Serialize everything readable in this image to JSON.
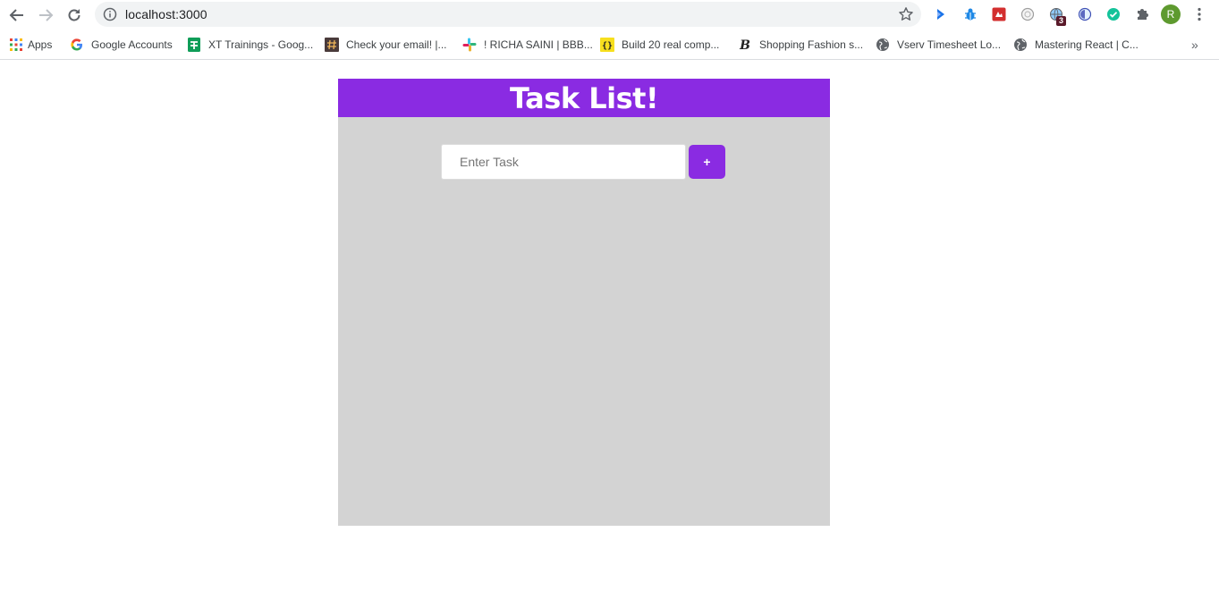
{
  "browser": {
    "url": "localhost:3000",
    "extension_badge": "3",
    "profile_initial": "R",
    "profile_color": "#5e9a2f",
    "bookmarks": [
      {
        "icon": "apps-grid-icon",
        "label": "Apps"
      },
      {
        "icon": "google-icon",
        "label": "Google Accounts"
      },
      {
        "icon": "sheets-icon",
        "label": "XT Trainings - Goog..."
      },
      {
        "icon": "hash-icon",
        "label": "Check your email! |..."
      },
      {
        "icon": "slack-icon",
        "label": "! RICHA SAINI | BBB..."
      },
      {
        "icon": "braces-icon",
        "label": "Build 20 real comp..."
      },
      {
        "icon": "script-b-icon",
        "label": "Shopping Fashion s..."
      },
      {
        "icon": "globe-icon",
        "label": "Vserv Timesheet Lo..."
      },
      {
        "icon": "globe-icon",
        "label": "Mastering React | C..."
      }
    ],
    "more_bookmarks": "»"
  },
  "app": {
    "title": "Task List!",
    "input_placeholder": "Enter Task",
    "input_value": "",
    "add_button_label": "+",
    "accent_color": "#8a2be2",
    "panel_color": "#d3d3d3"
  }
}
